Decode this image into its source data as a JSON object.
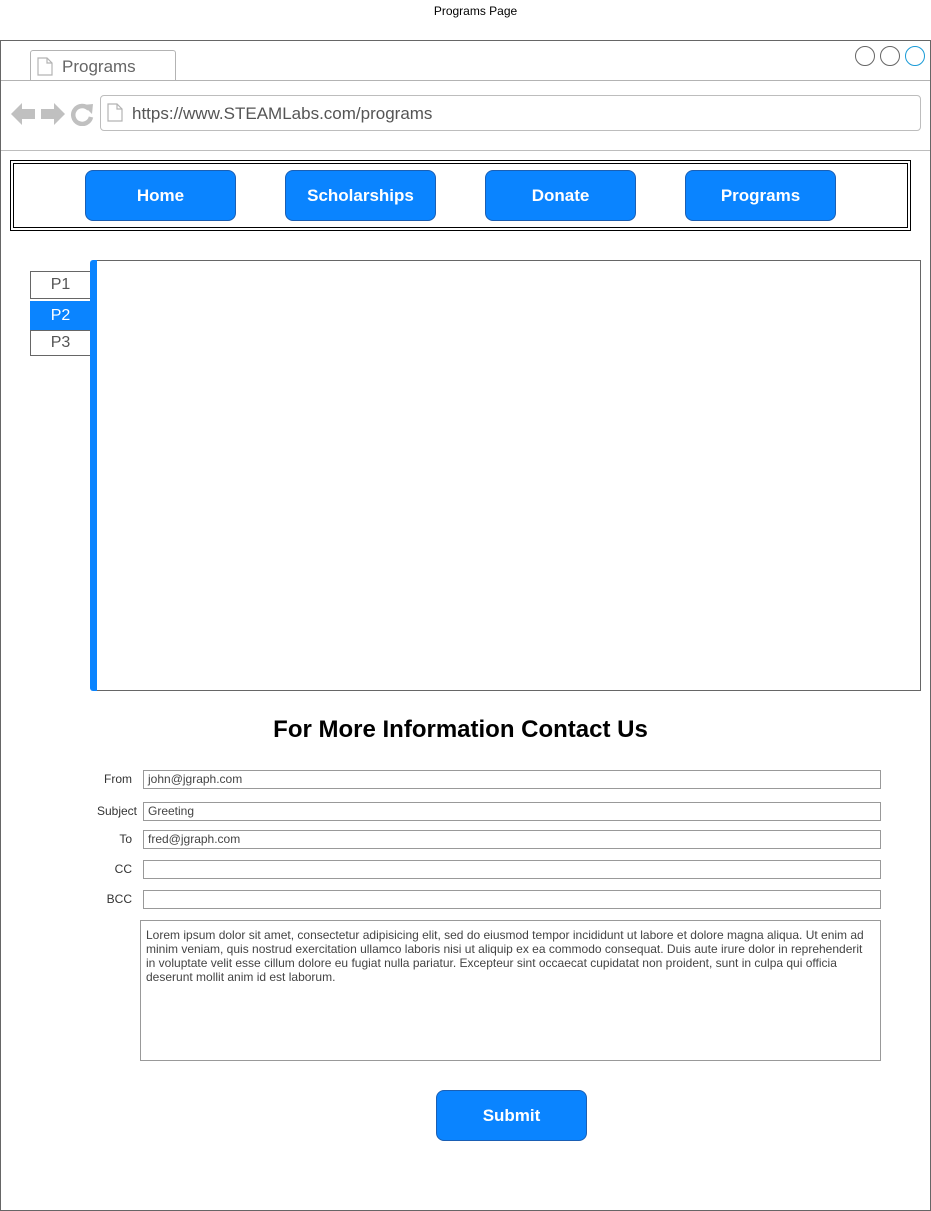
{
  "page_caption": "Programs Page",
  "browser": {
    "tab_label": "Programs",
    "url": "https://www.STEAMLabs.com/programs",
    "icons": [
      "document-icon",
      "back-arrow-icon",
      "forward-arrow-icon",
      "refresh-icon"
    ]
  },
  "navbar": {
    "home": "Home",
    "scholarships": "Scholarships",
    "donate": "Donate",
    "programs": "Programs",
    "button_color": "#0a84ff"
  },
  "vertical_tabs": {
    "p1": "P1",
    "p2": "P2",
    "p3": "P3",
    "active": "P2"
  },
  "contact": {
    "heading": "For More Information Contact Us",
    "from_label": "From",
    "from_value": "john@jgraph.com",
    "subject_label": "Subject",
    "subject_value": "Greeting",
    "to_label": "To",
    "to_value": "fred@jgraph.com",
    "cc_label": "CC",
    "cc_value": "",
    "bcc_label": "BCC",
    "bcc_value": "",
    "message": "Lorem ipsum dolor sit amet, consectetur adipisicing elit, sed do eiusmod tempor incididunt ut labore et dolore magna aliqua. Ut enim ad minim veniam, quis nostrud exercitation ullamco laboris nisi ut aliquip ex ea commodo consequat. Duis aute irure dolor in reprehenderit in voluptate velit esse cillum dolore eu fugiat nulla pariatur. Excepteur sint occaecat cupidatat non proident, sunt in culpa qui officia deserunt mollit anim id est laborum.",
    "submit": "Submit"
  }
}
